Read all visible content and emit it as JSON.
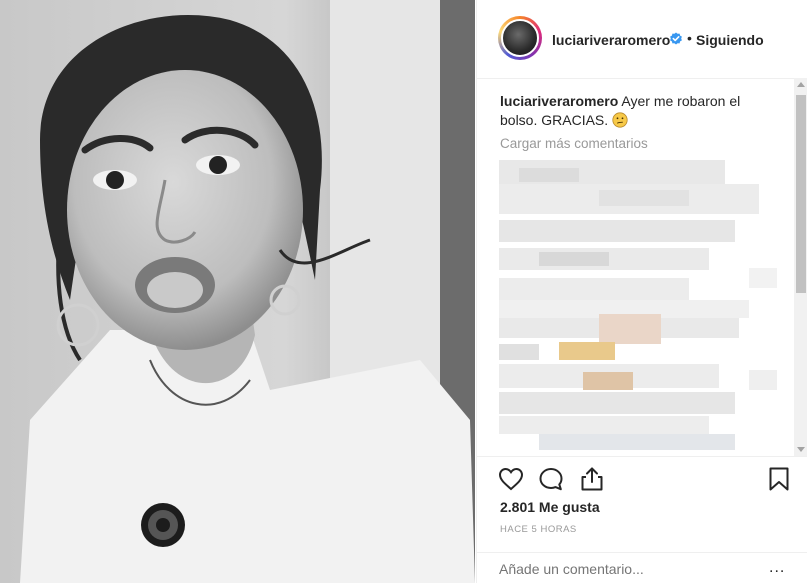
{
  "post": {
    "username": "luciariveraromero",
    "separator": "•",
    "follow_label": "Siguiendo",
    "caption_username": "luciariveraromero",
    "caption_text": " Ayer me robaron el bolso. GRACIAS. ",
    "caption_emoji": "😕",
    "load_more_comments": "Cargar más comentarios",
    "likes": "2.801 Me gusta",
    "timestamp": "HACE 5 HORAS",
    "comment_placeholder": "Añade un comentario...",
    "more_options": "..."
  },
  "icons": {
    "verified": "verified-badge-icon",
    "like": "heart-icon",
    "comment": "comment-bubble-icon",
    "share": "share-upload-icon",
    "save": "bookmark-icon"
  },
  "colors": {
    "verified_blue": "#3897f0",
    "muted_text": "#999999",
    "primary_text": "#262626"
  }
}
